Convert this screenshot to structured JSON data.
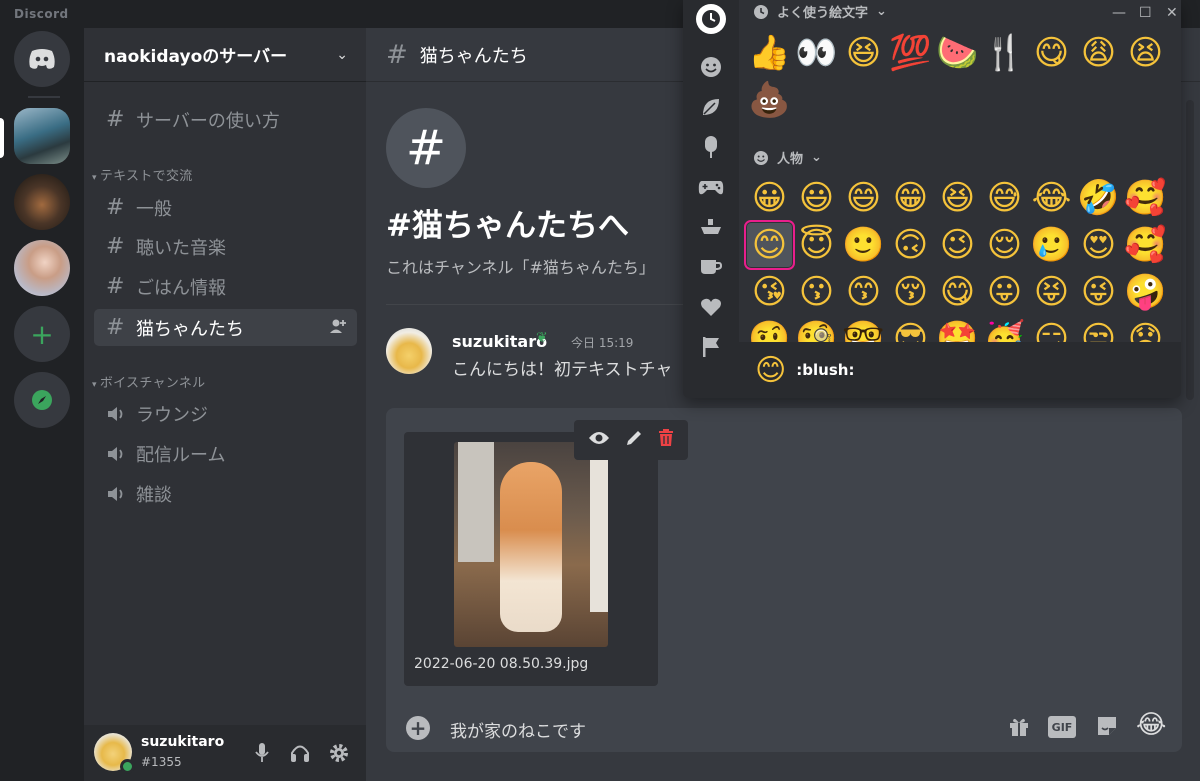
{
  "app": {
    "title": "Discord"
  },
  "server": {
    "name": "naokidayoのサーバー"
  },
  "channels": {
    "top": {
      "label": "サーバーの使い方"
    },
    "text_category": "テキストで交流",
    "text": [
      {
        "label": "一般"
      },
      {
        "label": "聴いた音楽"
      },
      {
        "label": "ごはん情報"
      },
      {
        "label": "猫ちゃんたち"
      }
    ],
    "voice_category": "ボイスチャンネル",
    "voice": [
      {
        "label": "ラウンジ"
      },
      {
        "label": "配信ルーム"
      },
      {
        "label": "雑談"
      }
    ]
  },
  "user": {
    "name": "suzukitaro",
    "tag": "#1355"
  },
  "chat": {
    "channel_name": "猫ちゃんたち",
    "welcome_title": "#猫ちゃんたちへ",
    "welcome_sub": "これはチャンネル「#猫ちゃんたち」",
    "message": {
      "author": "suzukitaro",
      "time": "今日 15:19",
      "text": "こんにちは！初テキストチャ"
    }
  },
  "composer": {
    "attachment_filename": "2022-06-20 08.50.39.jpg",
    "input_value": "我が家のねこです",
    "gif_label": "GIF"
  },
  "emoji_picker": {
    "frequent_title": "よく使う絵文字",
    "people_title": "人物",
    "frequent": [
      "👍",
      "👀",
      "😆",
      "💯",
      "🍉",
      "🍴",
      "😋",
      "😩",
      "😫",
      "💩"
    ],
    "people": [
      [
        "😀",
        "😃",
        "😄",
        "😁",
        "😆",
        "😅",
        "😂",
        "🤣",
        "🥰"
      ],
      [
        "😊",
        "😇",
        "🙂",
        "🙃",
        "😉",
        "😌",
        "🥲",
        "😍",
        "🥰"
      ],
      [
        "😘",
        "😗",
        "😙",
        "😚",
        "😋",
        "😛",
        "😝",
        "😜",
        "🤪"
      ],
      [
        "🤨",
        "🧐",
        "🤓",
        "😎",
        "🤩",
        "🥳",
        "😏",
        "😒",
        "😞"
      ]
    ],
    "preview_emoji": "😊",
    "preview_name": ":blush:"
  },
  "colors": {
    "accent_green": "#3ba55d",
    "danger_red": "#ed4245",
    "selection_outline": "#e91e8c",
    "background": "#36393f"
  }
}
